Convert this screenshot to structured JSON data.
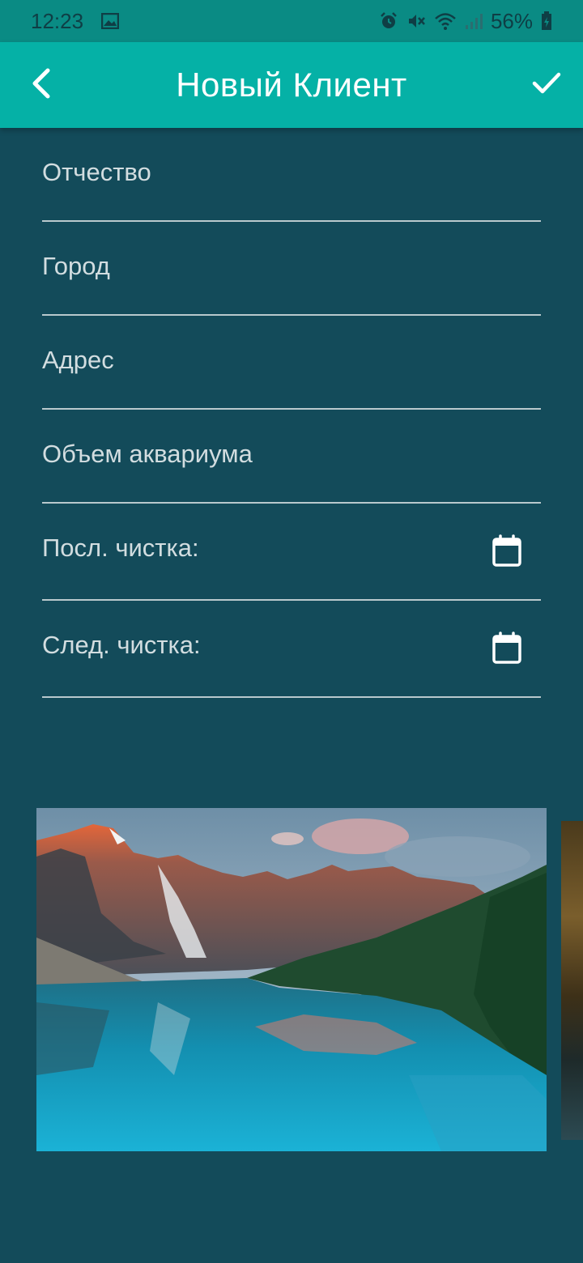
{
  "status_bar": {
    "time": "12:23",
    "battery_percent": "56%",
    "icons": [
      "image-icon",
      "alarm-icon",
      "mute-icon",
      "wifi-icon",
      "signal-icon",
      "battery-icon"
    ]
  },
  "app_bar": {
    "title": "Новый Клиент",
    "back_icon": "chevron-left-icon",
    "confirm_icon": "check-icon",
    "background": "#05b1a6"
  },
  "form": {
    "fields": [
      {
        "placeholder": "Отчество",
        "value": ""
      },
      {
        "placeholder": "Город",
        "value": ""
      },
      {
        "placeholder": "Адрес",
        "value": ""
      },
      {
        "placeholder": "Объем аквариума",
        "value": ""
      },
      {
        "placeholder": "Посл. чистка:",
        "value": "",
        "icon": "calendar-icon"
      },
      {
        "placeholder": "След. чистка:",
        "value": "",
        "icon": "calendar-icon"
      }
    ]
  },
  "gallery": {
    "images": [
      "mountain-lake-photo",
      "cave-photo"
    ]
  },
  "colors": {
    "background": "#134b5a",
    "status_bar": "#0a8b84",
    "accent": "#05b1a6"
  }
}
